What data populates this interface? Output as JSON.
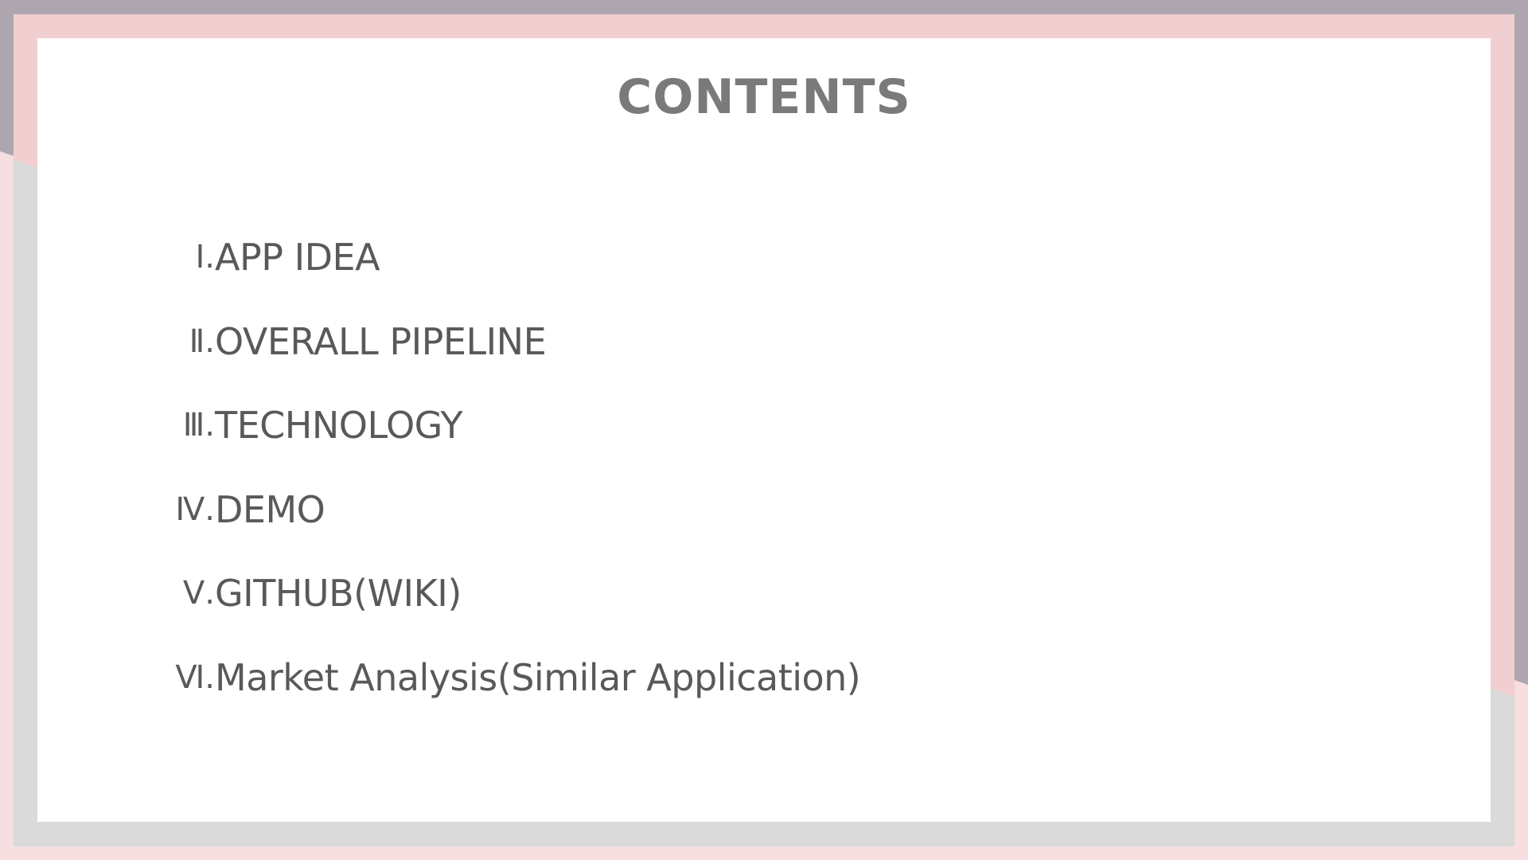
{
  "colors": {
    "outer_top": "#aea6ae",
    "outer_side": "#f7dfe1",
    "frame_pink": "#f1cfd0",
    "frame_gray": "#dadada",
    "card": "#ffffff",
    "title_text": "#7a7a7a",
    "item_text": "#595959"
  },
  "slide": {
    "title": "CONTENTS",
    "items": [
      {
        "numeral": "Ⅰ.",
        "label": "APP IDEA"
      },
      {
        "numeral": "Ⅱ.",
        "label": "OVERALL PIPELINE"
      },
      {
        "numeral": "Ⅲ.",
        "label": "TECHNOLOGY"
      },
      {
        "numeral": "Ⅳ.",
        "label": "DEMO"
      },
      {
        "numeral": "Ⅴ.",
        "label": "GITHUB(WIKI)"
      },
      {
        "numeral": "Ⅵ.",
        "label": "Market Analysis(Similar Application)"
      }
    ]
  }
}
